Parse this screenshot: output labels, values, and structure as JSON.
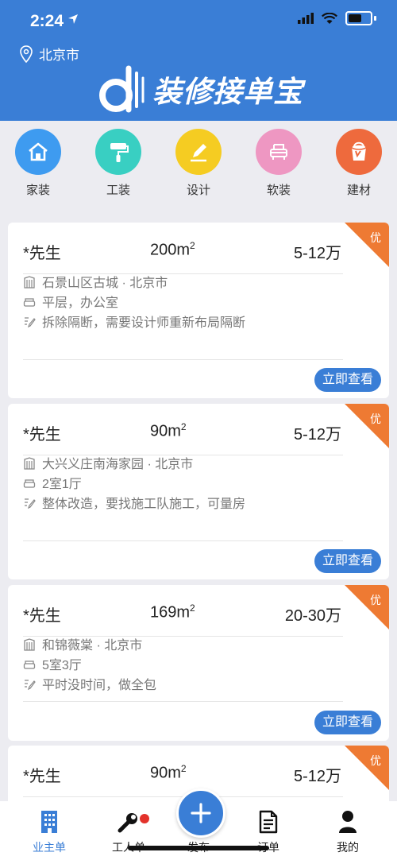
{
  "status": {
    "time": "2:24"
  },
  "header": {
    "city": "北京市",
    "logo_text": "装修接单宝"
  },
  "categories": [
    {
      "label": "家装",
      "icon": "house-icon",
      "color": "#3e9bf0"
    },
    {
      "label": "工装",
      "icon": "paint-roller-icon",
      "color": "#39cfc2"
    },
    {
      "label": "设计",
      "icon": "pencil-icon",
      "color": "#f5cc22"
    },
    {
      "label": "软装",
      "icon": "sofa-icon",
      "color": "#ee97c2"
    },
    {
      "label": "建材",
      "icon": "paint-bucket-icon",
      "color": "#ee6a3d"
    }
  ],
  "badge_label": "优",
  "view_button": "立即查看",
  "listings": [
    {
      "name": "*先生",
      "area": "200m",
      "price": "5-12万",
      "location": "石景山区古城 · 北京市",
      "type": "平层，办公室",
      "desc": "拆除隔断，需要设计师重新布局隔断"
    },
    {
      "name": "*先生",
      "area": "90m",
      "price": "5-12万",
      "location": "大兴义庄南海家园 · 北京市",
      "type": "2室1厅",
      "desc": "整体改造，要找施工队施工，可量房"
    },
    {
      "name": "*先生",
      "area": "169m",
      "price": "20-30万",
      "location": "和锦薇棠 · 北京市",
      "type": "5室3厅",
      "desc": "平时没时间，做全包"
    },
    {
      "name": "*先生",
      "area": "90m",
      "price": "5-12万"
    }
  ],
  "area_unit_sup": "2",
  "tabs": [
    {
      "label": "业主单",
      "active": true
    },
    {
      "label": "工人单"
    },
    {
      "label": "发布"
    },
    {
      "label": "订单"
    },
    {
      "label": "我的"
    }
  ],
  "colors": {
    "primary": "#3a7ed6",
    "badge": "#ee7a33",
    "notification": "#e3322b"
  }
}
